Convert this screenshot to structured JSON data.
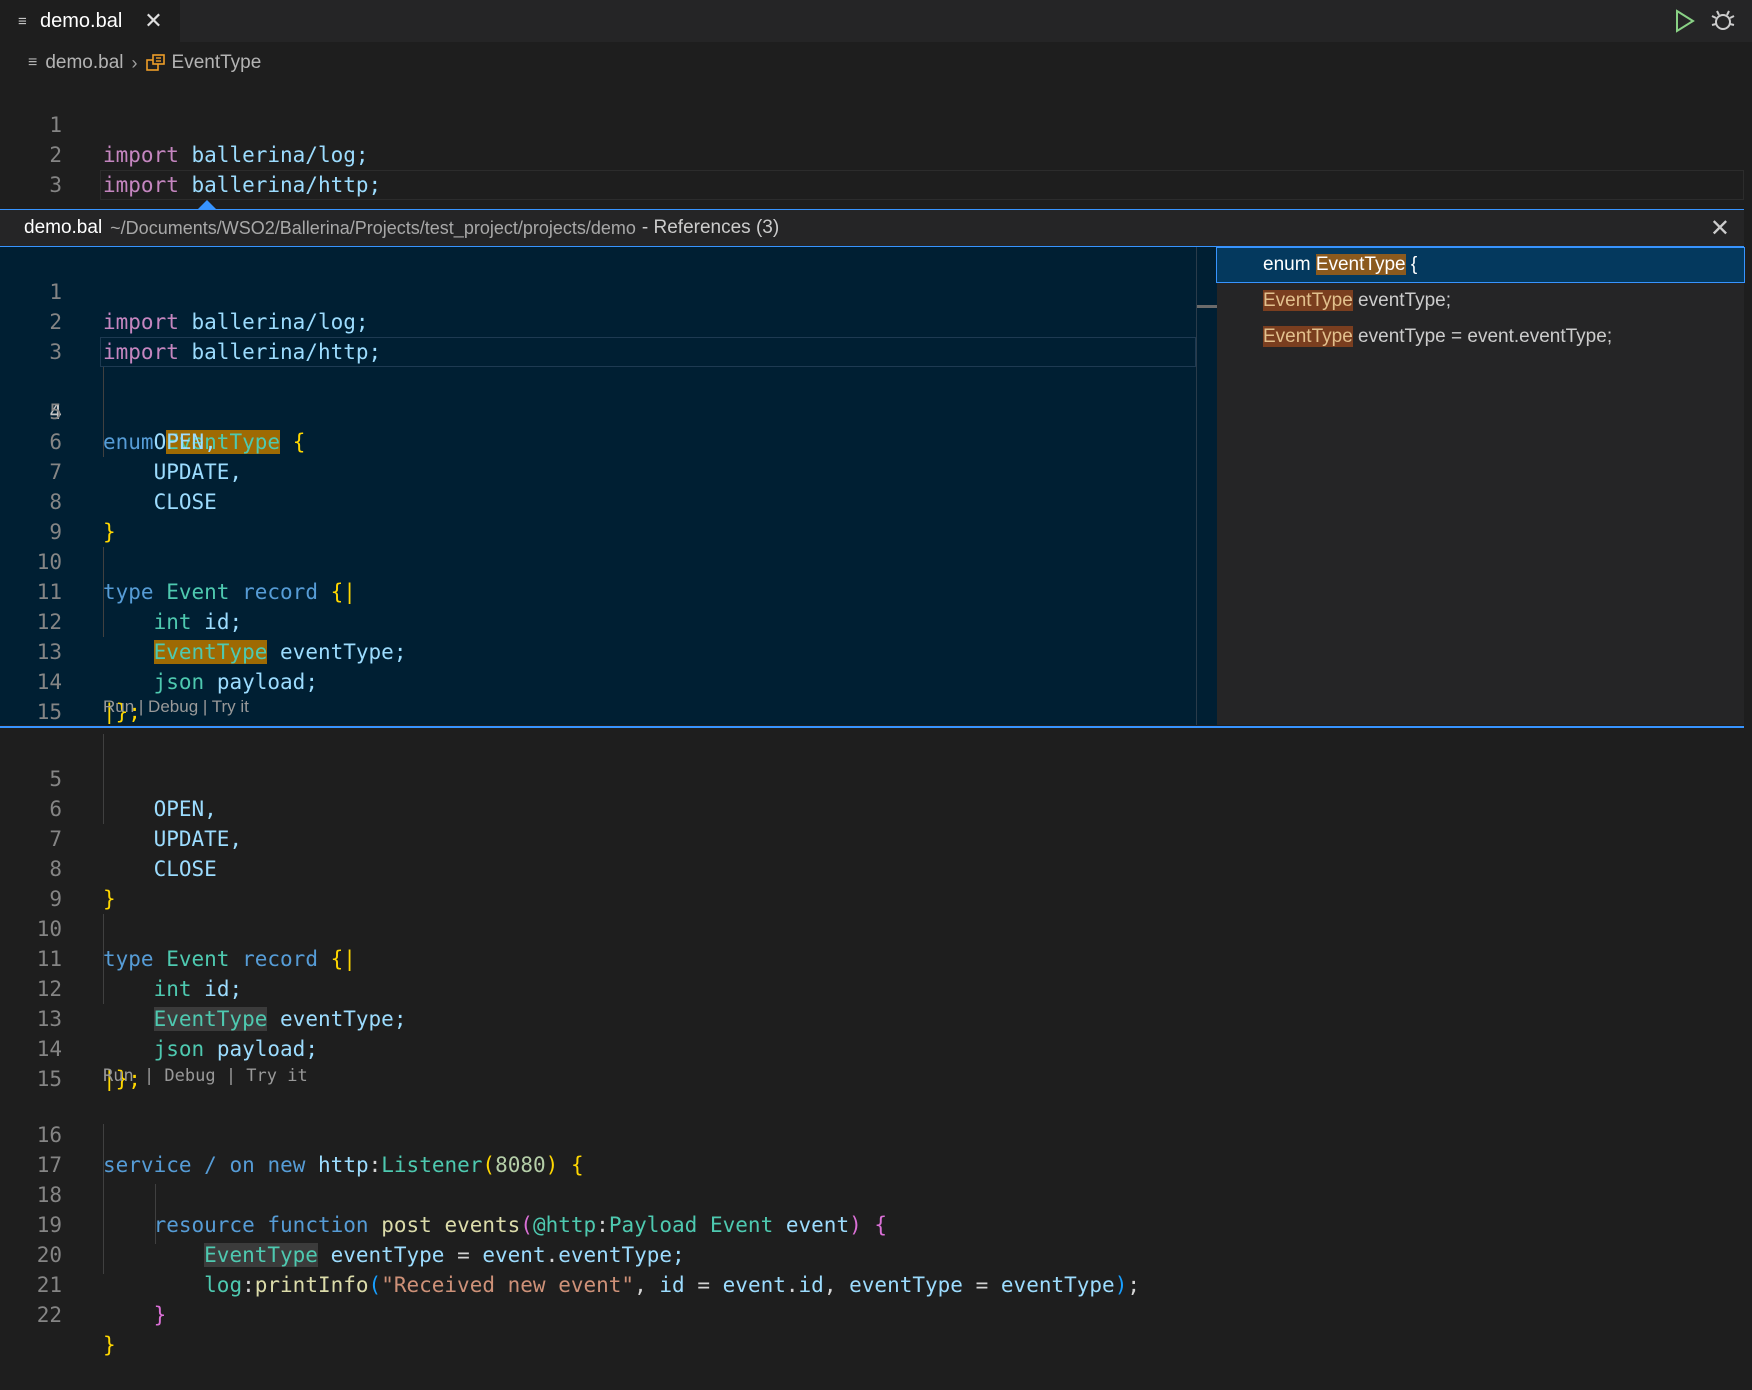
{
  "tab": {
    "title": "demo.bal",
    "close_glyph": "✕"
  },
  "toolbar": {
    "run_icon": "play-icon",
    "debug_icon": "debug-icon"
  },
  "breadcrumb": {
    "file": "demo.bal",
    "separator": "›",
    "symbol": "EventType"
  },
  "peek": {
    "file": "demo.bal",
    "path": "~/Documents/WSO2/Ballerina/Projects/test_project/projects/demo",
    "meta": "- References (3)",
    "close_glyph": "✕",
    "references": [
      {
        "before": "enum ",
        "match": "EventType",
        "after": " {"
      },
      {
        "before": "",
        "match": "EventType",
        "after": " eventType;"
      },
      {
        "before": "",
        "match": "EventType",
        "after": " eventType = event.eventType;"
      }
    ]
  },
  "codelens": {
    "text": "Run | Debug | Try it"
  },
  "line_numbers": {
    "top": [
      "1",
      "2",
      "3",
      "4"
    ],
    "peek": [
      "1",
      "2",
      "3",
      "4",
      "5",
      "6",
      "7",
      "8",
      "9",
      "10",
      "11",
      "12",
      "13",
      "14",
      "15"
    ],
    "bottom": [
      "5",
      "6",
      "7",
      "8",
      "9",
      "10",
      "11",
      "12",
      "13",
      "14",
      "15",
      "16",
      "17",
      "18",
      "19",
      "20",
      "21",
      "22"
    ]
  },
  "code": {
    "import_kw": "import",
    "import_log": "ballerina/log;",
    "import_http": "ballerina/http;",
    "enum_kw": "enum",
    "enum_name": "EventType",
    "open_brace": "{",
    "close_brace": "}",
    "open": "OPEN,",
    "update": "UPDATE,",
    "close": "CLOSE",
    "type_kw": "type",
    "event": "Event",
    "record_kw": "record",
    "rec_open": "{|",
    "rec_close_pipe": "|",
    "rec_close": "};",
    "int_kw": "int",
    "id_field": "id;",
    "eventtype_field": "eventType;",
    "json_kw": "json",
    "payload_field": "payload;",
    "service_kw": "service",
    "slash": "/",
    "on_kw": "on",
    "new_kw": "new",
    "http": "http",
    "colon": ":",
    "listener": "Listener",
    "lparen": "(",
    "port": "8080",
    "rparen": ")",
    "resource_kw": "resource",
    "function_kw": "function",
    "post": "post",
    "events": "events",
    "annotation": "@http",
    "payload_ann": "Payload",
    "param": "event",
    "var_eventtype": "eventType",
    "assign": "=",
    "event_access": "event",
    "dot": ".",
    "eventtype_prop": "eventType;",
    "log": "log",
    "print_info": "printInfo",
    "msg": "\"Received new event\"",
    "comma": ",",
    "id_arg": "id",
    "event_id": "event",
    "id_prop": "id",
    "eventtype_arg": "eventType",
    "eventtype_val": "eventType",
    "semicolon": ";"
  }
}
